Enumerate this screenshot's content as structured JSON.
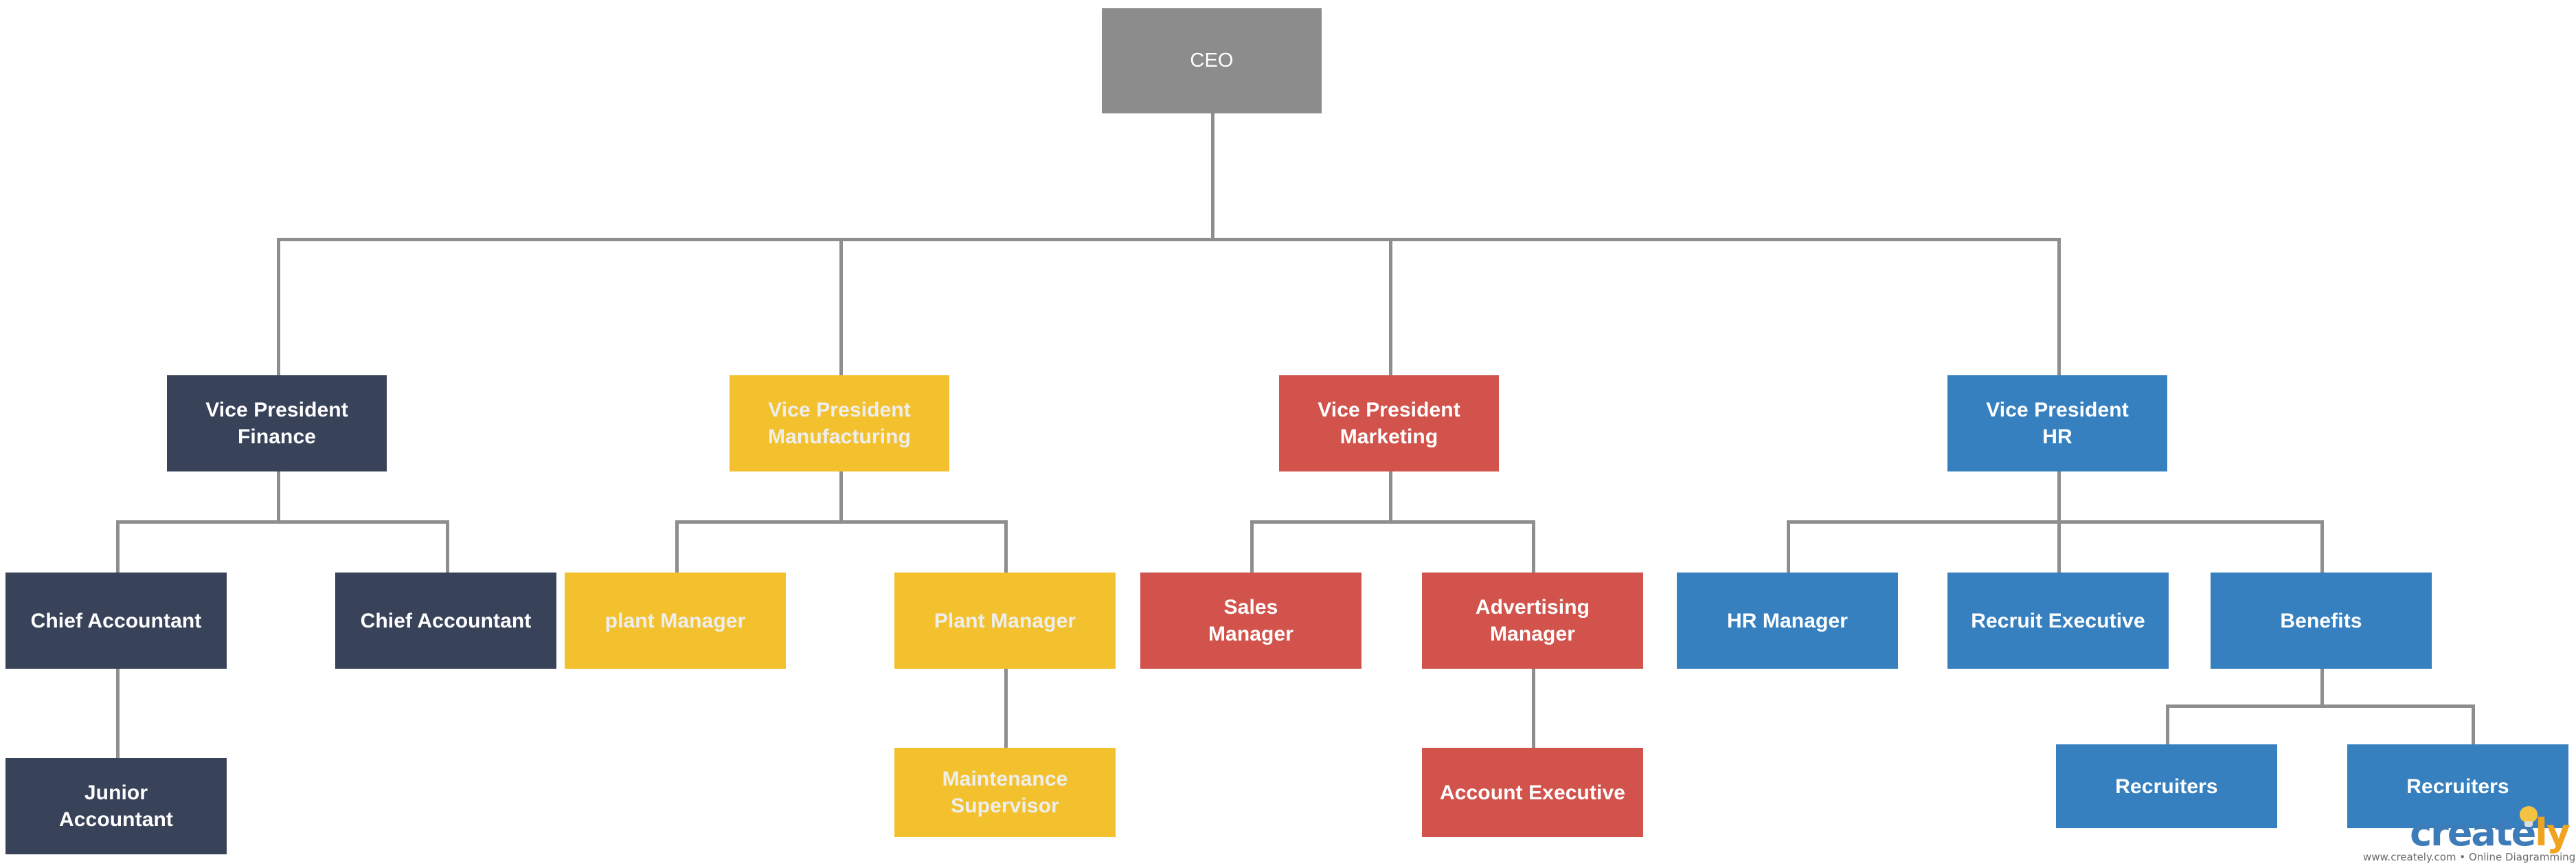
{
  "diagram": {
    "type": "organizational-chart",
    "title": "Organizational Chart",
    "background": "#ffffff",
    "connector_color": "#8e8e8e"
  },
  "palette": {
    "ceo_gray": "#8c8c8c",
    "finance_navy": "#384259",
    "manufacturing_yellow": "#f3c12e",
    "marketing_red": "#d1534c",
    "hr_blue": "#3680c0"
  },
  "nodes": {
    "ceo": {
      "label": "CEO"
    },
    "vp_finance": {
      "label": "Vice President\nFinance"
    },
    "vp_manufacturing": {
      "label": "Vice President\nManufacturing"
    },
    "vp_marketing": {
      "label": "Vice President\nMarketing"
    },
    "vp_hr": {
      "label": "Vice President\nHR"
    },
    "chief_accountant_1": {
      "label": "Chief Accountant"
    },
    "chief_accountant_2": {
      "label": "Chief Accountant"
    },
    "plant_manager_1": {
      "label": "plant Manager"
    },
    "plant_manager_2": {
      "label": "Plant Manager"
    },
    "sales_manager": {
      "label": "Sales\nManager"
    },
    "advertising_manager": {
      "label": "Advertising\nManager"
    },
    "hr_manager": {
      "label": "HR Manager"
    },
    "recruit_executive": {
      "label": "Recruit Executive"
    },
    "benefits": {
      "label": "Benefits"
    },
    "junior_accountant": {
      "label": "Junior\nAccountant"
    },
    "maintenance_supervisor": {
      "label": "Maintenance\nSupervisor"
    },
    "account_executive": {
      "label": "Account Executive"
    },
    "recruiters_1": {
      "label": "Recruiters"
    },
    "recruiters_2": {
      "label": "Recruiters"
    }
  },
  "watermark": {
    "brand_part1": "creat",
    "brand_part2": "e",
    "brand_part3": "ly",
    "tagline": "www.creately.com • Online Diagramming"
  }
}
